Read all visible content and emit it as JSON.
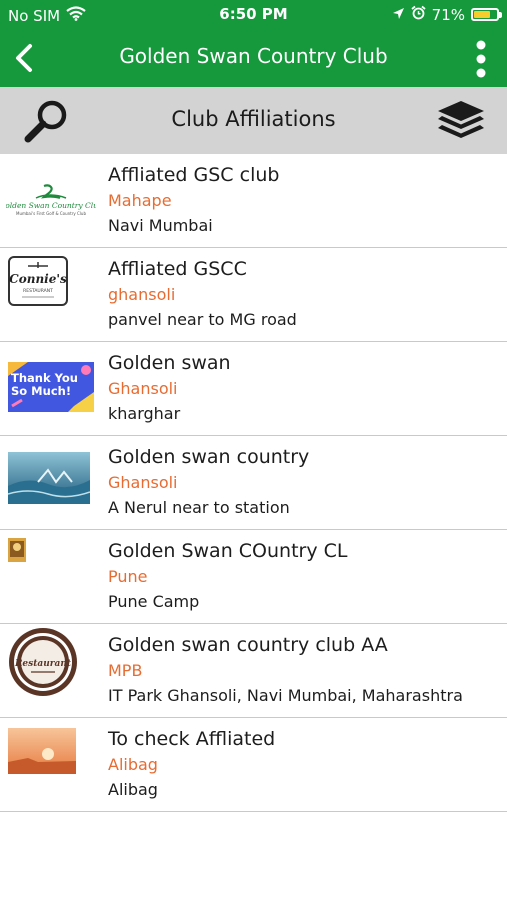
{
  "status_bar": {
    "carrier": "No SIM",
    "time": "6:50 PM",
    "battery_percent": "71%",
    "battery_level": 0.71
  },
  "nav": {
    "title": "Golden Swan Country Club"
  },
  "toolbar": {
    "title": "Club Affiliations"
  },
  "clubs": [
    {
      "name": "Affliated GSC club",
      "location": "Mahape",
      "address": "Navi Mumbai",
      "logo": {
        "title": "Golden Swan Country Club",
        "subtitle": "Mumbai's First Golf & Country Club"
      }
    },
    {
      "name": "Affliated GSCC",
      "location": "ghansoli",
      "address": "panvel near to MG road",
      "logo": {
        "title": "Connie's",
        "subtitle": "RESTAURANT"
      }
    },
    {
      "name": "Golden swan",
      "location": "Ghansoli",
      "address": "kharghar",
      "logo": {
        "title": "Thank You So Much!"
      }
    },
    {
      "name": "Golden swan country",
      "location": "Ghansoli",
      "address": "A Nerul near to station"
    },
    {
      "name": "Golden Swan COuntry CL",
      "location": "Pune",
      "address": "Pune Camp"
    },
    {
      "name": "Golden swan country club AA",
      "location": "MPB",
      "address": "IT Park Ghansoli, Navi Mumbai, Maharashtra",
      "logo": {
        "title": "Restaurant"
      }
    },
    {
      "name": "To check Affliated",
      "location": "Alibag",
      "address": "Alibag"
    }
  ],
  "colors": {
    "header_green": "#16993d",
    "toolbar_gray": "#d3d3d3",
    "location_orange": "#e76c32",
    "battery_yellow": "#f7cc2d"
  },
  "icons": [
    "wifi-icon",
    "location-arrow-icon",
    "alarm-icon",
    "battery-icon",
    "back-chevron-icon",
    "more-vertical-icon",
    "search-icon",
    "layers-icon"
  ]
}
